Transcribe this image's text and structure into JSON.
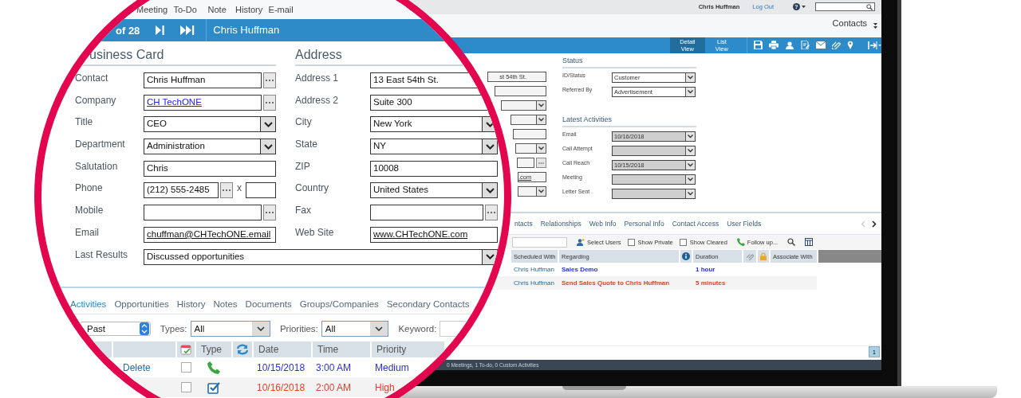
{
  "app": {
    "user": "Chris Huffman",
    "logout": "Log Out",
    "help": "?",
    "module": "Contacts",
    "views": [
      {
        "label": "Detail View",
        "selected": true
      },
      {
        "label": "List View",
        "selected": false
      }
    ],
    "side_fields": [
      {
        "kind": "text",
        "value": "st 54th St.",
        "underlined": false
      },
      {
        "kind": "text"
      },
      {
        "kind": "select"
      },
      {
        "kind": "select"
      },
      {
        "kind": "text"
      },
      {
        "kind": "select"
      },
      {
        "kind": "lookup"
      },
      {
        "kind": "text",
        "value": ".com",
        "underlined": true
      },
      {
        "kind": "select"
      }
    ],
    "status": {
      "title": "Status",
      "fields": [
        {
          "label": "ID/Status",
          "value": "Customer",
          "disabled": false
        },
        {
          "label": "Referred By",
          "value": "Advertisement",
          "disabled": false
        }
      ]
    },
    "latest_activities": {
      "title": "Latest Activities",
      "fields": [
        {
          "label": "Email",
          "value": "10/16/2018",
          "disabled": true
        },
        {
          "label": "Call Attempt",
          "disabled": true
        },
        {
          "label": "Call Reach",
          "value": "10/15/2018",
          "disabled": true
        },
        {
          "label": "Meeting",
          "disabled": true
        },
        {
          "label": "Letter Sent",
          "disabled": true
        }
      ]
    },
    "tabs": [
      {
        "label": "ntacts"
      },
      {
        "label": "Relationships"
      },
      {
        "label": "Web Info"
      },
      {
        "label": "Personal Info"
      },
      {
        "label": "Contact Access"
      },
      {
        "label": "User Fields"
      }
    ],
    "toolbar": {
      "select_users": "Select Users",
      "show_private": {
        "label": "Show Private",
        "checked": false
      },
      "show_cleared": {
        "label": "Show Cleared",
        "checked": false
      },
      "follow_up": "Follow up..."
    },
    "table": {
      "columns": [
        "Scheduled With",
        "Regarding",
        "Duration",
        "Associate With"
      ],
      "rows": [
        {
          "scheduled_with": "Chris Huffman",
          "regarding": "Sales Demo",
          "duration": "1 hour",
          "color": "#2233dd"
        },
        {
          "scheduled_with": "Chris Huffman",
          "regarding": "Send Sales Quote to Chris Huffman",
          "duration": "5 minutes",
          "color": "#e8402a"
        }
      ]
    },
    "page": "1",
    "status_bar": "0 Meetings, 1 To-do, 0 Custom Activities"
  },
  "lens": {
    "toolbar": [
      {
        "label": "Meeting"
      },
      {
        "label": "To-Do"
      },
      {
        "label": "Note"
      },
      {
        "label": "History"
      },
      {
        "label": "E-mail"
      }
    ],
    "record_bar": {
      "counter": "of 28",
      "contact": "Chris Huffman"
    },
    "sections": [
      {
        "title": "usiness Card",
        "fields": [
          {
            "label": "Contact",
            "kind": "lookup",
            "value": "Chris Huffman",
            "underlined": false
          },
          {
            "label": "Company",
            "kind": "lookup",
            "value": "CH TechONE",
            "underlined": true,
            "color": "#2222ee"
          },
          {
            "label": "Title",
            "kind": "select",
            "value": "CEO"
          },
          {
            "label": "Department",
            "kind": "select",
            "value": "Administration"
          },
          {
            "label": "Salutation",
            "kind": "text",
            "value": "Chris",
            "underlined": false
          },
          {
            "label": "Phone",
            "kind": "phone",
            "value": "(212) 555-2485",
            "ext_label": "x"
          },
          {
            "label": "Mobile",
            "kind": "lookup"
          },
          {
            "label": "Email",
            "kind": "text",
            "value": "chuffman@CHTechONE.email",
            "underlined": true
          }
        ]
      },
      {
        "title": "Address",
        "fields": [
          {
            "label": "Address 1",
            "kind": "text",
            "value": "13 East 54th St.",
            "underlined": false
          },
          {
            "label": "Address 2",
            "kind": "text",
            "value": "Suite 300",
            "underlined": false
          },
          {
            "label": "City",
            "kind": "select",
            "value": "New York"
          },
          {
            "label": "State",
            "kind": "select",
            "value": "NY"
          },
          {
            "label": "ZIP",
            "kind": "text",
            "value": "10008",
            "underlined": false
          },
          {
            "label": "Country",
            "kind": "select",
            "value": "United States"
          },
          {
            "label": "Fax",
            "kind": "lookup"
          },
          {
            "label": "Web Site",
            "kind": "text",
            "value": "www.CHTechONE.com",
            "underlined": true
          }
        ]
      }
    ],
    "last_results": {
      "label": "Last Results",
      "value": "Discussed opportunities"
    },
    "tabs": [
      {
        "label": "Activities",
        "selected": true
      },
      {
        "label": "Opportunities",
        "selected": false
      },
      {
        "label": "History",
        "selected": false
      },
      {
        "label": "Notes",
        "selected": false
      },
      {
        "label": "Documents",
        "selected": false
      },
      {
        "label": "Groups/Companies",
        "selected": false
      },
      {
        "label": "Secondary Contacts",
        "selected": false
      }
    ],
    "filters": {
      "period": "Past",
      "types_label": "Types:",
      "types": "All",
      "priorities_label": "Priorities:",
      "priorities": "All",
      "keyword_label": "Keyword:"
    },
    "table": {
      "columns": [
        "Type",
        "Date",
        "Time",
        "Priority"
      ],
      "rows": [
        {
          "action": "Delete",
          "done": false,
          "kind": "call",
          "date": "10/15/2018",
          "time": "3:00 AM",
          "priority": "Medium",
          "color": "#2a2ee6"
        },
        {
          "done": false,
          "kind": "task",
          "date": "10/16/2018",
          "time": "2:00 AM",
          "priority": "High",
          "color": "#e8402a"
        }
      ]
    }
  }
}
